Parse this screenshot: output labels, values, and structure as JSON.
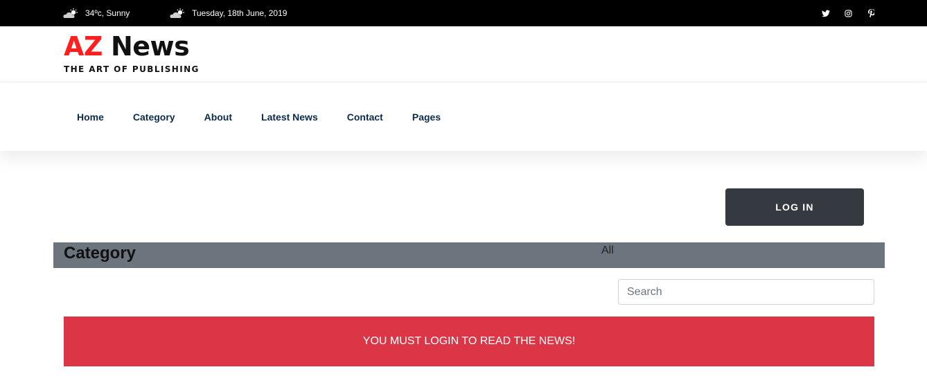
{
  "topbar": {
    "weather": {
      "icon": "cloud-sun-icon",
      "text": "34ºc, Sunny"
    },
    "date": {
      "icon": "cloud-sun-icon",
      "text": "Tuesday, 18th June, 2019"
    },
    "social": [
      "twitter-icon",
      "instagram-icon",
      "pinterest-icon"
    ]
  },
  "logo": {
    "az": "AZ",
    "news": "News",
    "tagline": "THE ART OF PUBLISHING",
    "colors": {
      "az": "#ff1f1f",
      "news": "#111111"
    }
  },
  "nav": {
    "items": [
      "Home",
      "Category",
      "About",
      "Latest News",
      "Contact",
      "Pages"
    ]
  },
  "login": {
    "label": "LOG IN"
  },
  "category": {
    "title": "Category",
    "selected": "All"
  },
  "search": {
    "placeholder": "Search",
    "value": ""
  },
  "alert": {
    "message": "YOU MUST LOGIN TO READ THE NEWS!",
    "color": "#dc3545"
  },
  "colors": {
    "topbar": "#000000",
    "nav_text": "#0b2a4a",
    "button": "#343a40",
    "category_bar": "#6c757d"
  }
}
